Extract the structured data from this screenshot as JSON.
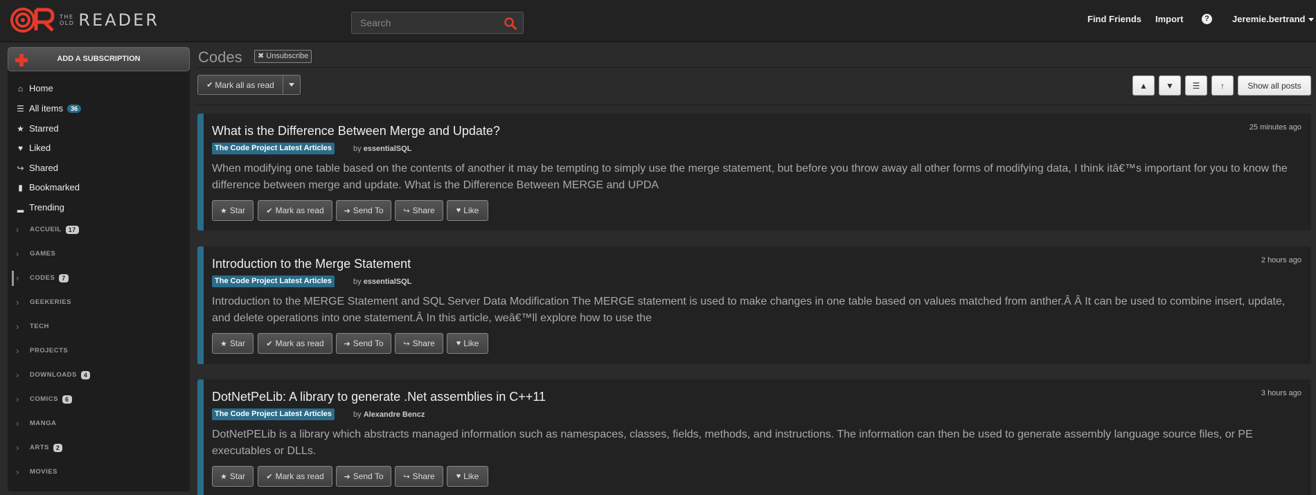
{
  "header": {
    "logo_small_1": "THE",
    "logo_small_2": "OLD",
    "logo_big": "READER",
    "search_placeholder": "Search",
    "nav": [
      "Find Friends",
      "Import"
    ],
    "help": "?",
    "user": "Jeremie.bertrand"
  },
  "colors": {
    "accent": "#2b6c8a",
    "brand": "#e53a2b",
    "background": "#2b2b2b"
  },
  "sidebar": {
    "add_subscription": "ADD A SUBSCRIPTION",
    "items": [
      {
        "label": "Home",
        "icon": "home-icon",
        "glyph": "⌂"
      },
      {
        "label": "All items",
        "icon": "list-icon",
        "glyph": "☰",
        "count": "36"
      },
      {
        "label": "Starred",
        "icon": "star-icon",
        "glyph": "★"
      },
      {
        "label": "Liked",
        "icon": "heart-icon",
        "glyph": "♥"
      },
      {
        "label": "Shared",
        "icon": "share-icon",
        "glyph": "↪"
      },
      {
        "label": "Bookmarked",
        "icon": "bookmark-icon",
        "glyph": "▮"
      },
      {
        "label": "Trending",
        "icon": "signal-icon",
        "glyph": "▂"
      }
    ],
    "folders": [
      {
        "label": "ACCUEIL",
        "count": "17"
      },
      {
        "label": "GAMES"
      },
      {
        "label": "CODES",
        "count": "7",
        "active": true
      },
      {
        "label": "GEEKERIES"
      },
      {
        "label": "TECH"
      },
      {
        "label": "PROJECTS"
      },
      {
        "label": "DOWNLOADS",
        "count": "4"
      },
      {
        "label": "COMICS",
        "count": "6"
      },
      {
        "label": "MANGA"
      },
      {
        "label": "ARTS",
        "count": "2"
      },
      {
        "label": "MOVIES"
      }
    ]
  },
  "main": {
    "title": "Codes",
    "unsubscribe": "Unsubscribe",
    "mark_all_read": "Mark all as read",
    "show_all_posts": "Show all posts",
    "articles": [
      {
        "title": "What is the Difference Between Merge and Update?",
        "time": "25 minutes ago",
        "feed": "The Code Project Latest Articles",
        "by": "by",
        "author": "essentialSQL",
        "excerpt": "When modifying one table based on the contents of another it may be tempting to simply use the merge statement, but before you throw away all other forms of modifying data, I think itâ€™s important for you to know the difference between merge and update. What is the Difference Between MERGE and UPDA"
      },
      {
        "title": "Introduction to the Merge Statement",
        "time": "2 hours ago",
        "feed": "The Code Project Latest Articles",
        "by": "by",
        "author": "essentialSQL",
        "excerpt": "Introduction to the MERGE Statement and SQL Server Data Modification The MERGE statement is used to make changes in one table based on values matched from anther.Â Â  It can be used to combine insert, update, and delete operations into one statement.Â  In this article, weâ€™ll explore how to use the"
      },
      {
        "title": "DotNetPeLib: A library to generate .Net assemblies in C++11",
        "time": "3 hours ago",
        "feed": "The Code Project Latest Articles",
        "by": "by",
        "author": "Alexandre Bencz",
        "excerpt": "DotNetPELib is a library which abstracts managed information such as namespaces, classes, fields, methods, and instructions. The information can then be used to generate assembly language source files, or PE executables or DLLs."
      }
    ],
    "article_buttons": [
      "Star",
      "Mark as read",
      "Send To",
      "Share",
      "Like"
    ]
  }
}
